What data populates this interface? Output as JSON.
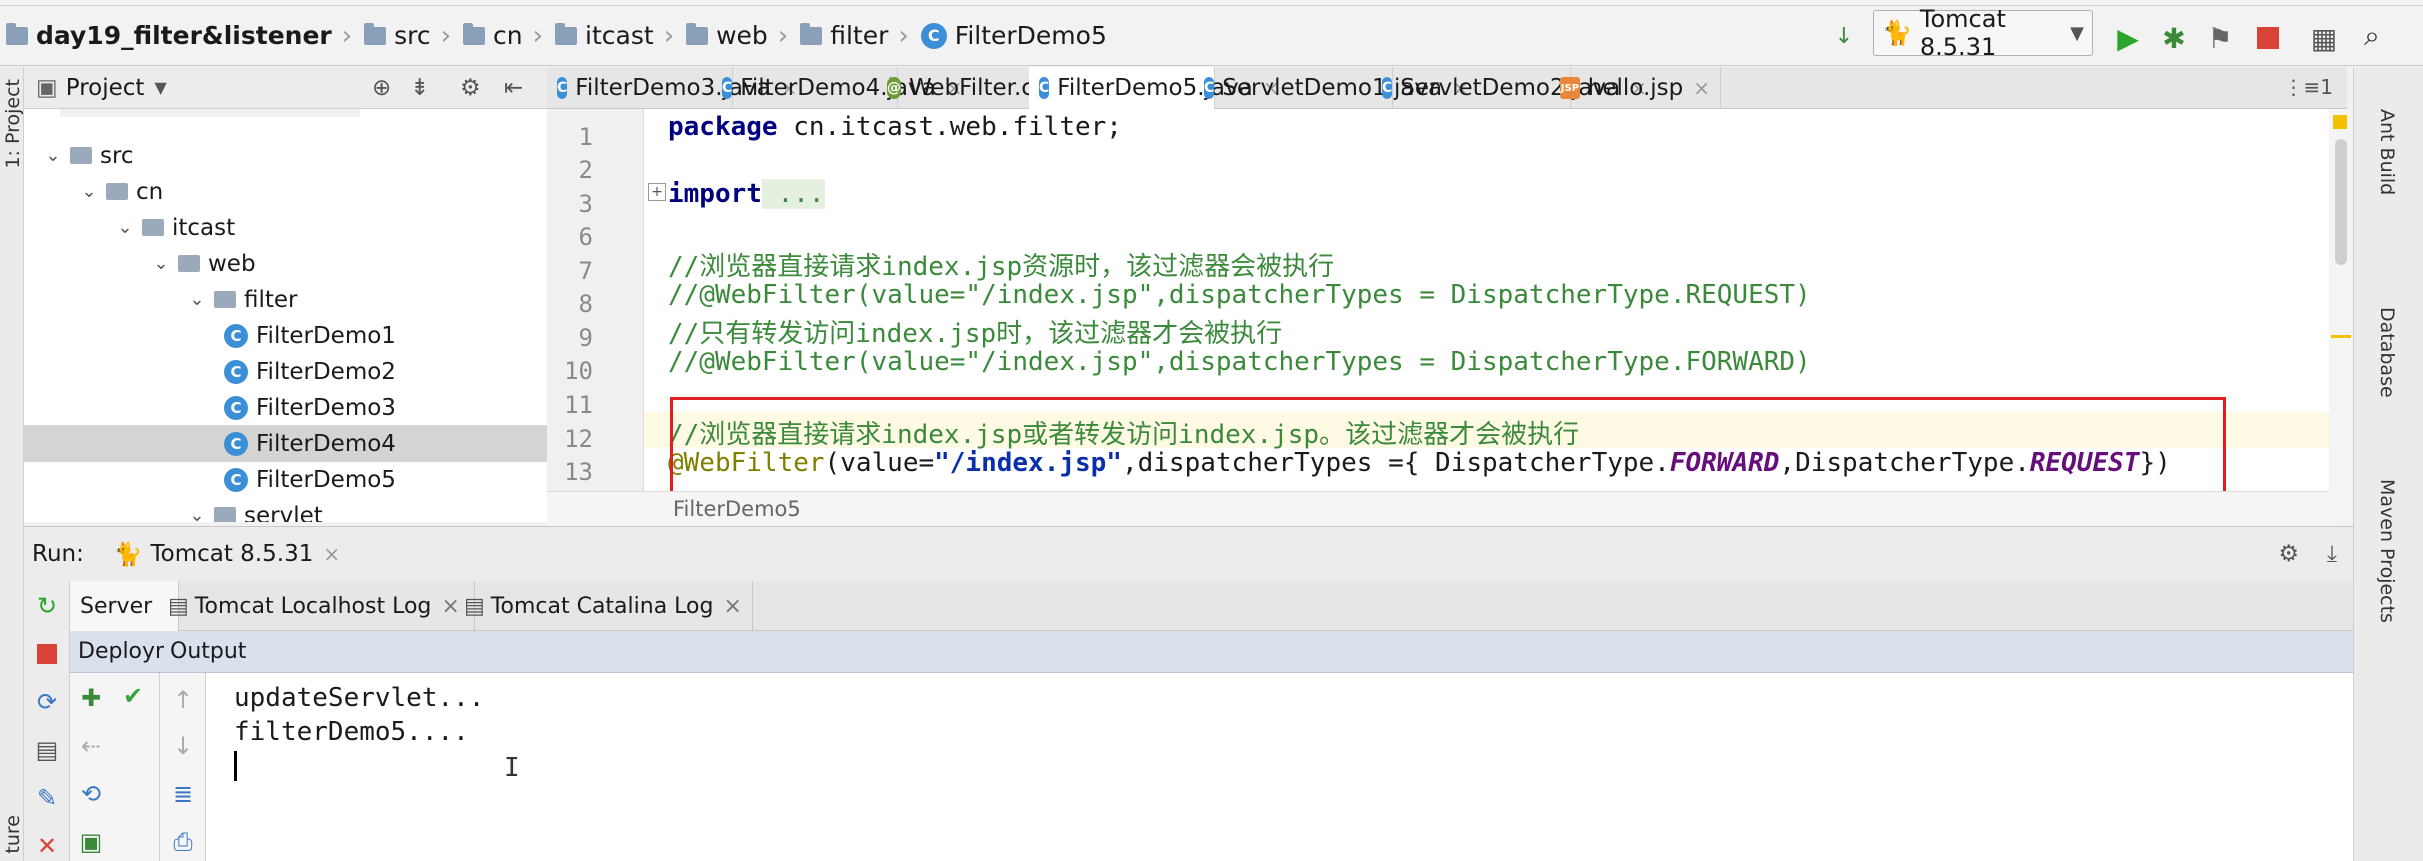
{
  "navbar": {
    "crumbs": [
      "day19_filter&listener",
      "src",
      "cn",
      "itcast",
      "web",
      "filter",
      "FilterDemo5"
    ],
    "run_config": "Tomcat 8.5.31"
  },
  "left_strip": {
    "project_label": "1: Project",
    "structure_label": "ture"
  },
  "project": {
    "title": "Project",
    "tree": [
      {
        "label": "src",
        "kind": "folder",
        "level": 1,
        "expanded": true
      },
      {
        "label": "cn",
        "kind": "folder",
        "level": 2,
        "expanded": true
      },
      {
        "label": "itcast",
        "kind": "folder",
        "level": 3,
        "expanded": true
      },
      {
        "label": "web",
        "kind": "folder",
        "level": 4,
        "expanded": true
      },
      {
        "label": "filter",
        "kind": "folder",
        "level": 5,
        "expanded": true
      },
      {
        "label": "FilterDemo1",
        "kind": "class",
        "level": 6
      },
      {
        "label": "FilterDemo2",
        "kind": "class",
        "level": 6
      },
      {
        "label": "FilterDemo3",
        "kind": "class",
        "level": 6
      },
      {
        "label": "FilterDemo4",
        "kind": "class",
        "level": 6,
        "selected": true
      },
      {
        "label": "FilterDemo5",
        "kind": "class",
        "level": 6
      },
      {
        "label": "servlet",
        "kind": "folder",
        "level": 5,
        "expanded": true
      }
    ]
  },
  "editor": {
    "tabs": [
      {
        "label": "FilterDemo3.java",
        "active": false
      },
      {
        "label": "FilterDemo4.java",
        "active": false
      },
      {
        "label": "WebFilter.class",
        "active": false
      },
      {
        "label": "FilterDemo5.java",
        "active": true
      },
      {
        "label": "ServletDemo1.java",
        "active": false
      },
      {
        "label": "ServletDemo2.java",
        "active": false
      },
      {
        "label": "hello.jsp",
        "active": false
      }
    ],
    "tab_overflow": "⋮≡1",
    "line_numbers": [
      "1",
      "2",
      "3",
      "6",
      "7",
      "8",
      "9",
      "10",
      "11",
      "12",
      "13"
    ],
    "code": {
      "l1_kw": "package",
      "l1_rest": " cn.itcast.web.filter;",
      "l3_kw": "import",
      "l3_rest": " ...",
      "l7": "//浏览器直接请求index.jsp资源时，该过滤器会被执行",
      "l8": "//@WebFilter(value=\"/index.jsp\",dispatcherTypes = DispatcherType.REQUEST)",
      "l9": "//只有转发访问index.jsp时，该过滤器才会被执行",
      "l10": "//@WebFilter(value=\"/index.jsp\",dispatcherTypes = DispatcherType.FORWARD)",
      "l12": "//浏览器直接请求index.jsp或者转发访问index.jsp。该过滤器才会被执行",
      "l13_ann": "@WebFilter",
      "l13_a": "(value=",
      "l13_str": "\"/index.jsp\"",
      "l13_b": ",dispatcherTypes ={ DispatcherType.",
      "l13_f": "FORWARD",
      "l13_c": ",DispatcherType.",
      "l13_r": "REQUEST",
      "l13_d": "})"
    },
    "breadcrumb": "FilterDemo5"
  },
  "right_strip": {
    "items": [
      "Ant Build",
      "Database",
      "Maven Projects"
    ]
  },
  "run": {
    "label": "Run:",
    "config_tab": "Tomcat 8.5.31",
    "tabs": [
      "Server",
      "Tomcat Localhost Log",
      "Tomcat Catalina Log"
    ],
    "deploy_label": "Deploym",
    "output_label": "Output",
    "console_lines": [
      "updateServlet...",
      "filterDemo5...."
    ]
  }
}
